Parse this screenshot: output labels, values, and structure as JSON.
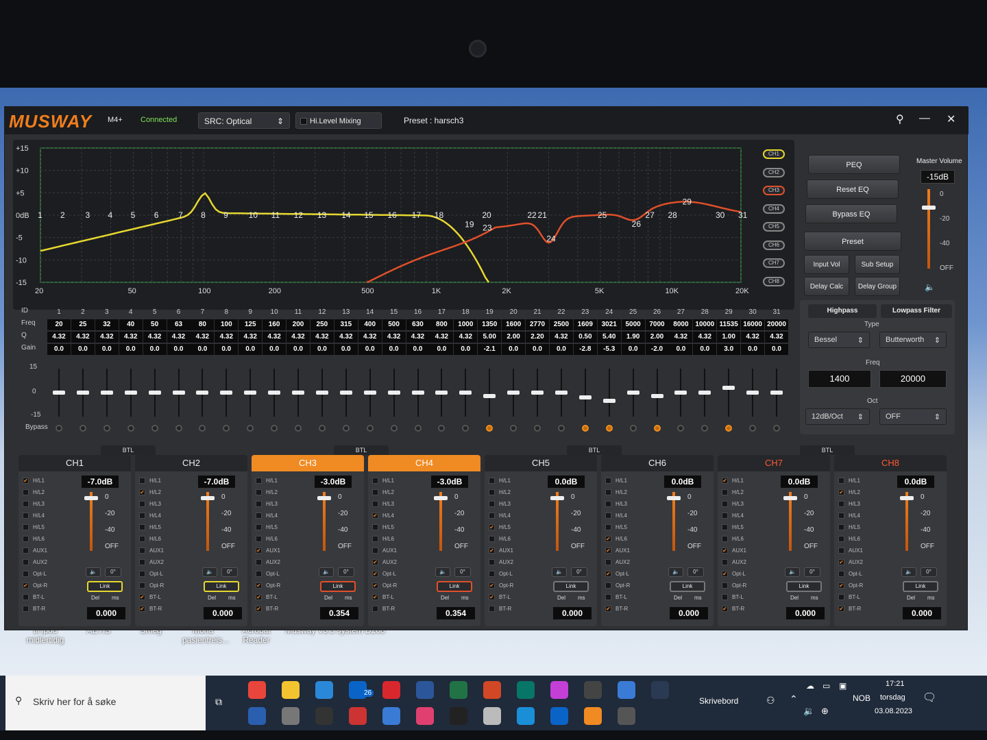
{
  "titlebar": {
    "logo": "MUSWAY",
    "model": "M4+",
    "status": "Connected",
    "src": "SRC: Optical",
    "hilevel": "Hi.Level Mixing",
    "preset": "Preset : harsch3"
  },
  "graph": {
    "y_ticks": [
      "+15",
      "+10",
      "+5",
      "0dB",
      "-5",
      "-10",
      "-15"
    ],
    "x_ticks": [
      "20",
      "50",
      "100",
      "200",
      "500",
      "1K",
      "2K",
      "5K",
      "10K",
      "20K"
    ],
    "band_labels": [
      "1",
      "2",
      "3",
      "4",
      "5",
      "6",
      "7",
      "8",
      "9",
      "10",
      "11",
      "12",
      "13",
      "14",
      "15",
      "16",
      "17",
      "18",
      "19",
      "20",
      "21",
      "22",
      "23",
      "24",
      "25",
      "26",
      "27",
      "28",
      "29",
      "30",
      "31"
    ],
    "ch_buttons": [
      "CH1",
      "CH2",
      "CH3",
      "CH4",
      "CH5",
      "CH6",
      "CH7",
      "CH8"
    ]
  },
  "right": {
    "peq": "PEQ",
    "reset": "Reset EQ",
    "bypass": "Bypass EQ",
    "preset": "Preset",
    "input_vol": "Input Vol",
    "sub_setup": "Sub Setup",
    "delay_calc": "Delay Calc",
    "delay_group": "Delay Group",
    "master_label": "Master Volume",
    "master_value": "-15dB",
    "master_scale": [
      "0",
      "-20",
      "-40",
      "OFF"
    ],
    "highpass": "Highpass",
    "lowpass": "Lowpass Filter",
    "type_label": "Type",
    "hp_type": "Bessel",
    "lp_type": "Butterworth",
    "freq_label": "Freq",
    "hp_freq": "1400",
    "lp_freq": "20000",
    "oct_label": "Oct",
    "hp_oct": "12dB/Oct",
    "lp_oct": "OFF"
  },
  "table": {
    "row_labels": {
      "id": "ID",
      "freq": "Freq",
      "q": "Q",
      "gain": "Gain",
      "bypass": "Bypass",
      "f_top": "15",
      "f_mid": "0",
      "f_bot": "-15"
    },
    "ids": [
      "1",
      "2",
      "3",
      "4",
      "5",
      "6",
      "7",
      "8",
      "9",
      "10",
      "11",
      "12",
      "13",
      "14",
      "15",
      "16",
      "17",
      "18",
      "19",
      "20",
      "21",
      "22",
      "23",
      "24",
      "25",
      "26",
      "27",
      "28",
      "29",
      "30",
      "31"
    ],
    "freq": [
      "20",
      "25",
      "32",
      "40",
      "50",
      "63",
      "80",
      "100",
      "125",
      "160",
      "200",
      "250",
      "315",
      "400",
      "500",
      "630",
      "800",
      "1000",
      "1350",
      "1600",
      "2770",
      "2500",
      "1609",
      "3021",
      "5000",
      "7000",
      "8000",
      "10000",
      "11535",
      "16000",
      "20000"
    ],
    "q": [
      "4.32",
      "4.32",
      "4.32",
      "4.32",
      "4.32",
      "4.32",
      "4.32",
      "4.32",
      "4.32",
      "4.32",
      "4.32",
      "4.32",
      "4.32",
      "4.32",
      "4.32",
      "4.32",
      "4.32",
      "4.32",
      "5.00",
      "2.00",
      "2.20",
      "4.32",
      "0.50",
      "5.40",
      "1.90",
      "2.00",
      "4.32",
      "4.32",
      "1.00",
      "4.32",
      "4.32"
    ],
    "gain": [
      "0.0",
      "0.0",
      "0.0",
      "0.0",
      "0.0",
      "0.0",
      "0.0",
      "0.0",
      "0.0",
      "0.0",
      "0.0",
      "0.0",
      "0.0",
      "0.0",
      "0.0",
      "0.0",
      "0.0",
      "0.0",
      "-2.1",
      "0.0",
      "0.0",
      "0.0",
      "-2.8",
      "-5.3",
      "0.0",
      "-2.0",
      "0.0",
      "0.0",
      "3.0",
      "0.0",
      "0.0"
    ],
    "bypass_on": [
      false,
      false,
      false,
      false,
      false,
      false,
      false,
      false,
      false,
      false,
      false,
      false,
      false,
      false,
      false,
      false,
      false,
      false,
      true,
      false,
      false,
      false,
      true,
      true,
      false,
      true,
      false,
      false,
      true,
      false,
      false
    ]
  },
  "channels": [
    {
      "name": "CH1",
      "vol": "-7.0dB",
      "delay": "0.000",
      "active": false,
      "checked": [
        0,
        9,
        12,
        13,
        14
      ]
    },
    {
      "name": "CH2",
      "vol": "-7.0dB",
      "delay": "0.000",
      "active": false,
      "checked": [
        1,
        10,
        11,
        12,
        13
      ]
    },
    {
      "name": "CH3",
      "vol": "-3.0dB",
      "delay": "0.354",
      "active": true,
      "checked": [
        6,
        9,
        10,
        11,
        12
      ]
    },
    {
      "name": "CH4",
      "vol": "-3.0dB",
      "delay": "0.354",
      "active": true,
      "checked": [
        3,
        7,
        8,
        9,
        10
      ]
    },
    {
      "name": "CH5",
      "vol": "0.0dB",
      "delay": "0.000",
      "active": false,
      "checked": [
        4,
        6,
        9,
        10,
        12,
        13
      ]
    },
    {
      "name": "CH6",
      "vol": "0.0dB",
      "delay": "0.000",
      "active": false,
      "checked": [
        5,
        6,
        8,
        11,
        12
      ]
    },
    {
      "name": "CH7",
      "vol": "0.0dB",
      "delay": "0.000",
      "active": false,
      "checked": [
        0,
        6,
        8,
        11
      ]
    },
    {
      "name": "CH8",
      "vol": "0.0dB",
      "delay": "0.000",
      "active": false,
      "checked": [
        1,
        7,
        9,
        11
      ]
    }
  ],
  "channel_ui": {
    "inputs": [
      "H/L1",
      "H/L2",
      "H/L3",
      "H/L4",
      "H/L5",
      "H/L6",
      "AUX1",
      "AUX2",
      "Opt-L",
      "Opt-R",
      "BT-L",
      "BT-R"
    ],
    "scale": [
      "0",
      "-20",
      "-40",
      "OFF"
    ],
    "link": "Link",
    "del": "Del",
    "ms": "ms",
    "phase": "0°",
    "btl": "BTL"
  },
  "desktop_icons": [
    "til ipod midlertidig",
    "AETIS",
    "Smeg",
    "Mona pasientreis...",
    "Acrobat Reader",
    "Musway V3.3 system D208"
  ],
  "taskbar": {
    "search": "Skriv her for å søke",
    "mail_badge": "26",
    "desktop": "Skrivebord",
    "lang": "NOB",
    "time": "17:21",
    "day": "torsdag",
    "date": "03.08.2023"
  }
}
